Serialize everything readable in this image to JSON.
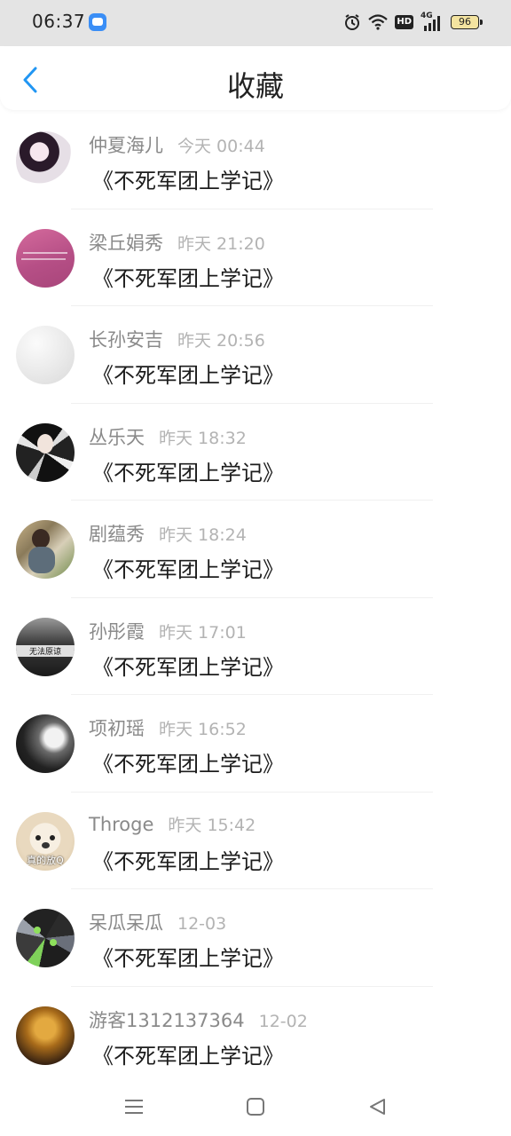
{
  "status_bar": {
    "time": "06:37",
    "icons": [
      "app-notification-icon",
      "alarm-icon",
      "wifi-icon",
      "hd-icon",
      "4g-signal-icon"
    ],
    "hd_label": "HD",
    "network_label": "4G",
    "battery": "96"
  },
  "header": {
    "back_icon": "chevron-left-icon",
    "title": "收藏",
    "accent_color": "#2196f3"
  },
  "favorites": [
    {
      "user": "仲夏海儿",
      "time": "今天 00:44",
      "book": "《不死军团上学记》",
      "avatar_caption": ""
    },
    {
      "user": "梁丘娟秀",
      "time": "昨天 21:20",
      "book": "《不死军团上学记》",
      "avatar_caption": ""
    },
    {
      "user": "长孙安吉",
      "time": "昨天 20:56",
      "book": "《不死军团上学记》",
      "avatar_caption": ""
    },
    {
      "user": "丛乐天",
      "time": "昨天 18:32",
      "book": "《不死军团上学记》",
      "avatar_caption": ""
    },
    {
      "user": "剧蕴秀",
      "time": "昨天 18:24",
      "book": "《不死军团上学记》",
      "avatar_caption": ""
    },
    {
      "user": "孙彤霞",
      "time": "昨天 17:01",
      "book": "《不死军团上学记》",
      "avatar_caption": "无法原谅"
    },
    {
      "user": "项初瑶",
      "time": "昨天 16:52",
      "book": "《不死军团上学记》",
      "avatar_caption": ""
    },
    {
      "user": "Throge",
      "time": "昨天 15:42",
      "book": "《不死军团上学记》",
      "avatar_caption": "真的放Q"
    },
    {
      "user": "呆瓜呆瓜",
      "time": "12-03",
      "book": "《不死军团上学记》",
      "avatar_caption": ""
    },
    {
      "user": "游客1312137364",
      "time": "12-02",
      "book": "《不死军团上学记》",
      "avatar_caption": ""
    }
  ],
  "nav_bar": {
    "buttons": [
      "menu-icon",
      "home-square-icon",
      "back-triangle-icon"
    ]
  }
}
